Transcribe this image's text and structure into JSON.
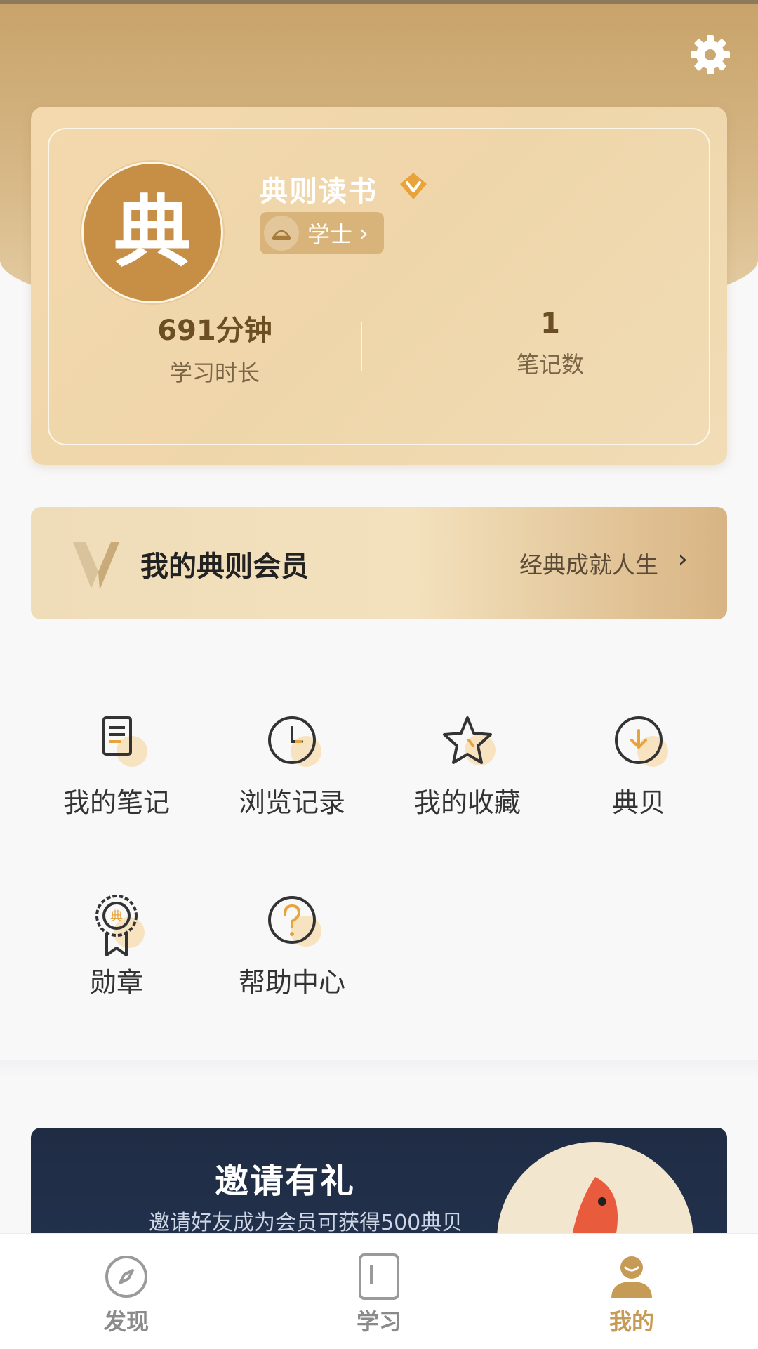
{
  "colors": {
    "accent": "#c69b55",
    "brand_gold": "#d8b47a",
    "text_dark": "#333333",
    "tab_inactive": "#8b8b8b"
  },
  "header": {
    "settings_icon": "gear-icon"
  },
  "profile": {
    "avatar_glyph": "典",
    "username": "典则读书",
    "vip_badge_icon": "vip-diamond-icon",
    "rank": {
      "icon": "scholar-hat-icon",
      "label": "学士",
      "chevron": "›"
    },
    "stats": [
      {
        "value": "691分钟",
        "label": "学习时长"
      },
      {
        "value": "1",
        "label": "笔记数"
      }
    ]
  },
  "vip_banner": {
    "title": "我的典则会员",
    "subtitle": "经典成就人生",
    "chevron": "›"
  },
  "menu": [
    {
      "label": "我的笔记",
      "icon": "notes-icon"
    },
    {
      "label": "浏览记录",
      "icon": "history-clock-icon"
    },
    {
      "label": "我的收藏",
      "icon": "favorite-star-icon"
    },
    {
      "label": "典贝",
      "icon": "coin-download-icon"
    },
    {
      "label": "勋章",
      "icon": "medal-icon"
    },
    {
      "label": "帮助中心",
      "icon": "help-icon"
    }
  ],
  "invite": {
    "title": "邀请有礼",
    "subtitle": "邀请好友成为会员可获得500典贝"
  },
  "tabbar": {
    "active": "我的",
    "tabs": [
      {
        "label": "发现",
        "icon": "compass-icon"
      },
      {
        "label": "学习",
        "icon": "book-icon"
      },
      {
        "label": "我的",
        "icon": "user-icon"
      }
    ]
  }
}
